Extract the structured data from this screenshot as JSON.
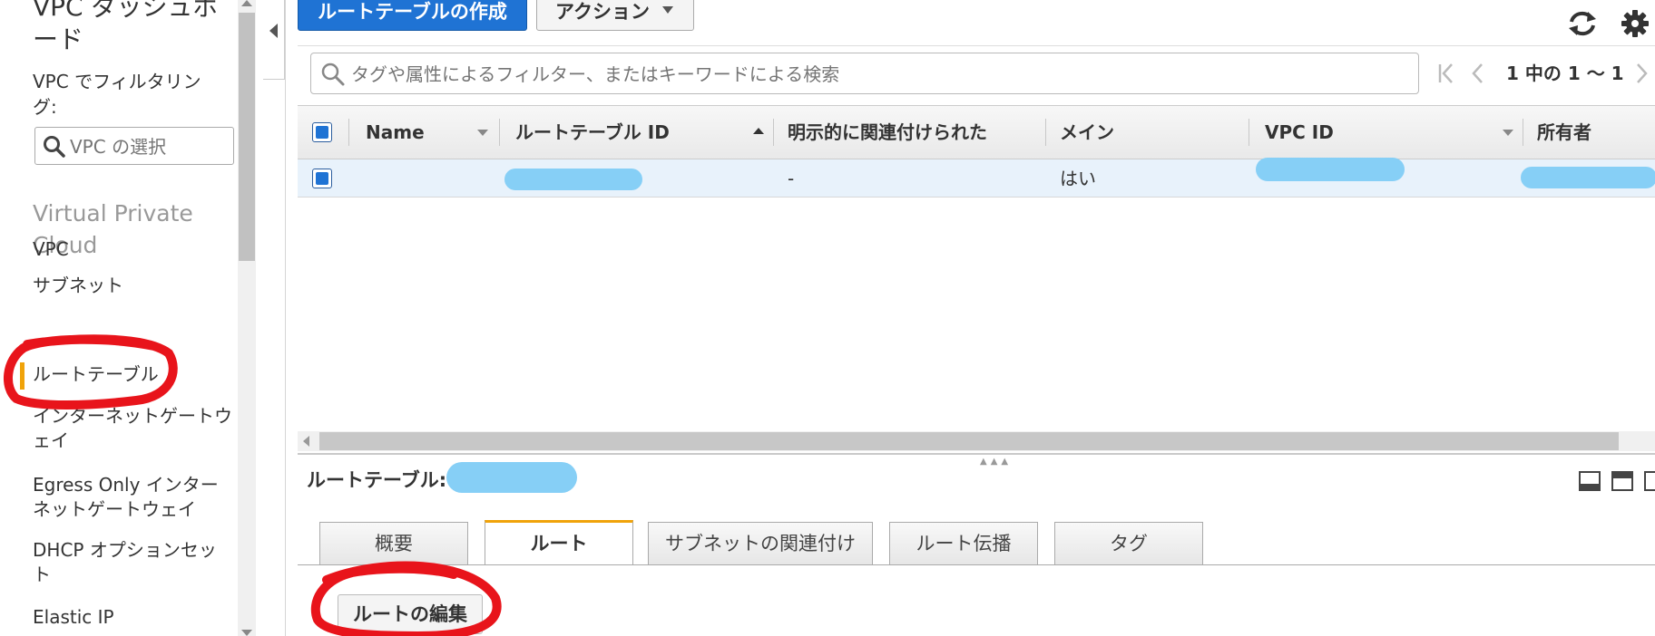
{
  "sidebar": {
    "title": "VPC ダッシュボード",
    "filter_label": "VPC でフィルタリング:",
    "vpc_select_placeholder": "VPC の選択",
    "section_title": "Virtual Private Cloud",
    "items": [
      {
        "label": "VPC"
      },
      {
        "label": "サブネット"
      },
      {
        "label": "ルートテーブル",
        "active": true
      },
      {
        "label": "インターネットゲートウェイ"
      },
      {
        "label": "Egress Only インターネットゲートウェイ"
      },
      {
        "label": "DHCP オプションセット"
      },
      {
        "label": "Elastic IP"
      }
    ]
  },
  "toolbar": {
    "create_label": "ルートテーブルの作成",
    "actions_label": "アクション"
  },
  "icons": {
    "refresh": "refresh-icon",
    "settings": "gear-icon",
    "search": "search-icon"
  },
  "filter": {
    "placeholder": "タグや属性によるフィルター、またはキーワードによる検索"
  },
  "pagination": {
    "text": "1 中の 1 ～ 1"
  },
  "table": {
    "columns": [
      "Name",
      "ルートテーブル ID",
      "明示的に関連付けられた",
      "メイン",
      "VPC ID",
      "所有者"
    ],
    "rows": [
      {
        "name": "",
        "route_table_id": "",
        "explicit": "-",
        "main": "はい",
        "vpc_id": "",
        "owner": ""
      }
    ]
  },
  "detail": {
    "title": "ルートテーブル:",
    "tabs": [
      {
        "label": "概要"
      },
      {
        "label": "ルート",
        "active": true
      },
      {
        "label": "サブネットの関連付け"
      },
      {
        "label": "ルート伝播"
      },
      {
        "label": "タグ"
      }
    ],
    "edit_routes_label": "ルートの編集"
  },
  "colors": {
    "primary_button": "#1f73d4",
    "active_accent": "#f0a30a",
    "redaction": "#86cff6",
    "annotation": "#e8141b",
    "selected_row": "#e8f2fb"
  }
}
